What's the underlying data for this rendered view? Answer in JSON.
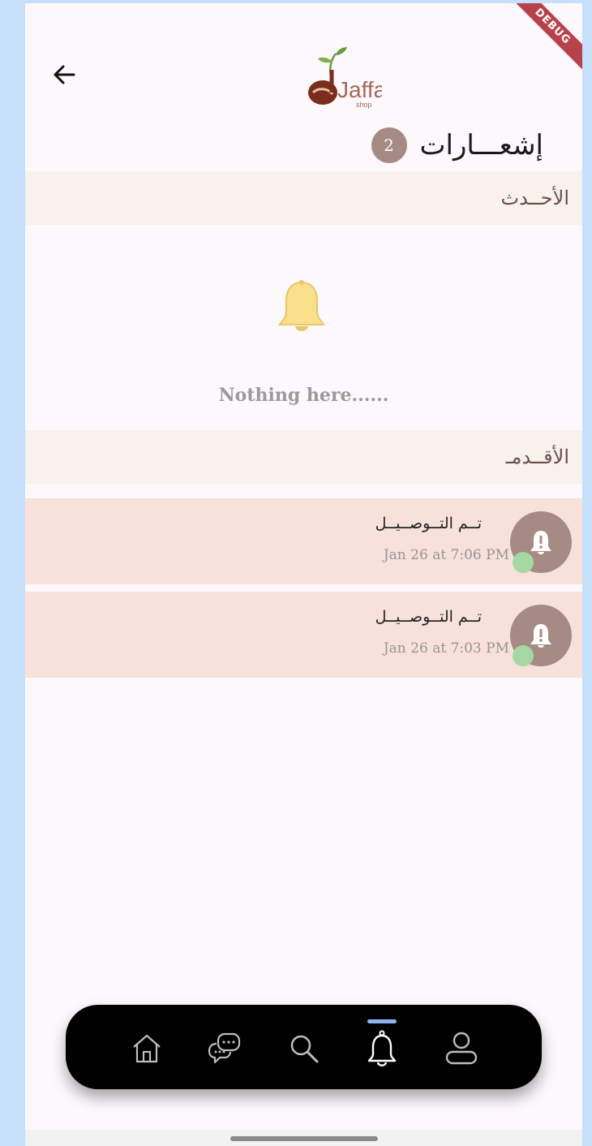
{
  "app": {
    "logo_text": "Jaffa",
    "logo_sub": "shop",
    "debug_banner": "DEBUG"
  },
  "header": {
    "title": "إشعـــارات",
    "count": "2"
  },
  "sections": {
    "latest": {
      "label": "الأحــدث",
      "empty_text": "Nothing here......"
    },
    "older": {
      "label": "الأقــدمـ"
    }
  },
  "notifications": [
    {
      "title": "تــم التــوصــيــل",
      "time": "Jan 26 at 7:06 PM"
    },
    {
      "title": "تــم التــوصــيــل",
      "time": "Jan 26 at 7:03 PM"
    }
  ],
  "nav": {
    "items": [
      {
        "name": "home",
        "icon": "home-icon",
        "active": false
      },
      {
        "name": "chat",
        "icon": "chat-icon",
        "active": false
      },
      {
        "name": "search",
        "icon": "search-icon",
        "active": false
      },
      {
        "name": "notifications",
        "icon": "bell-icon",
        "active": true
      },
      {
        "name": "profile",
        "icon": "profile-icon",
        "active": false
      }
    ]
  },
  "colors": {
    "accent": "#a68a84",
    "section_bg": "#f8f1ec",
    "notif_bg": "#f7e1da",
    "nav_bg": "#000000",
    "nav_indicator": "#8fb5f0"
  }
}
